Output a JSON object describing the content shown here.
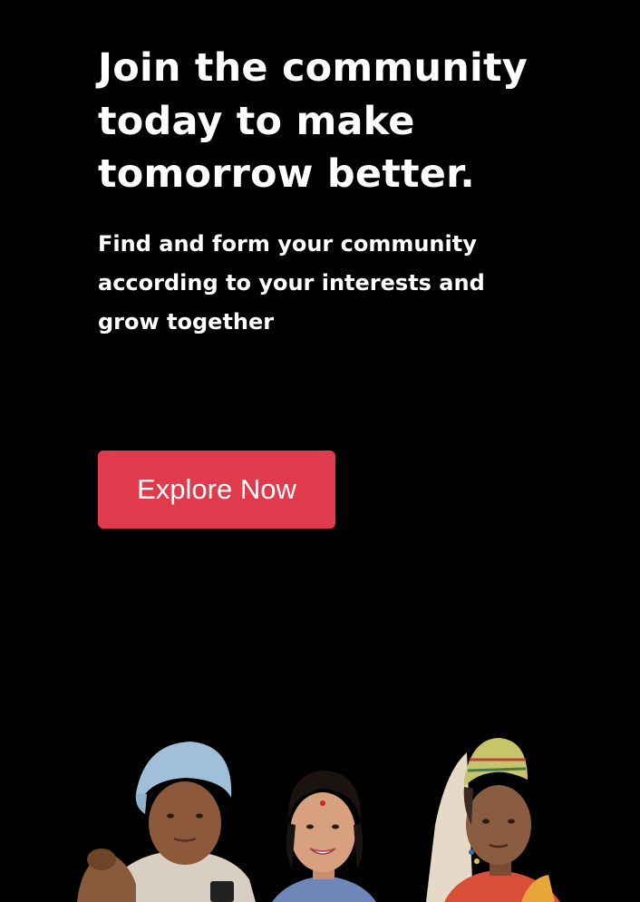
{
  "hero": {
    "headline": "Join the community today to make tomorrow better.",
    "subheadline": "Find and form your community according to your interests and grow together"
  },
  "cta": {
    "label": "Explore Now",
    "color": "#e03a4c"
  },
  "colors": {
    "background": "#000000",
    "text": "#ffffff",
    "accent": "#e03a4c"
  }
}
